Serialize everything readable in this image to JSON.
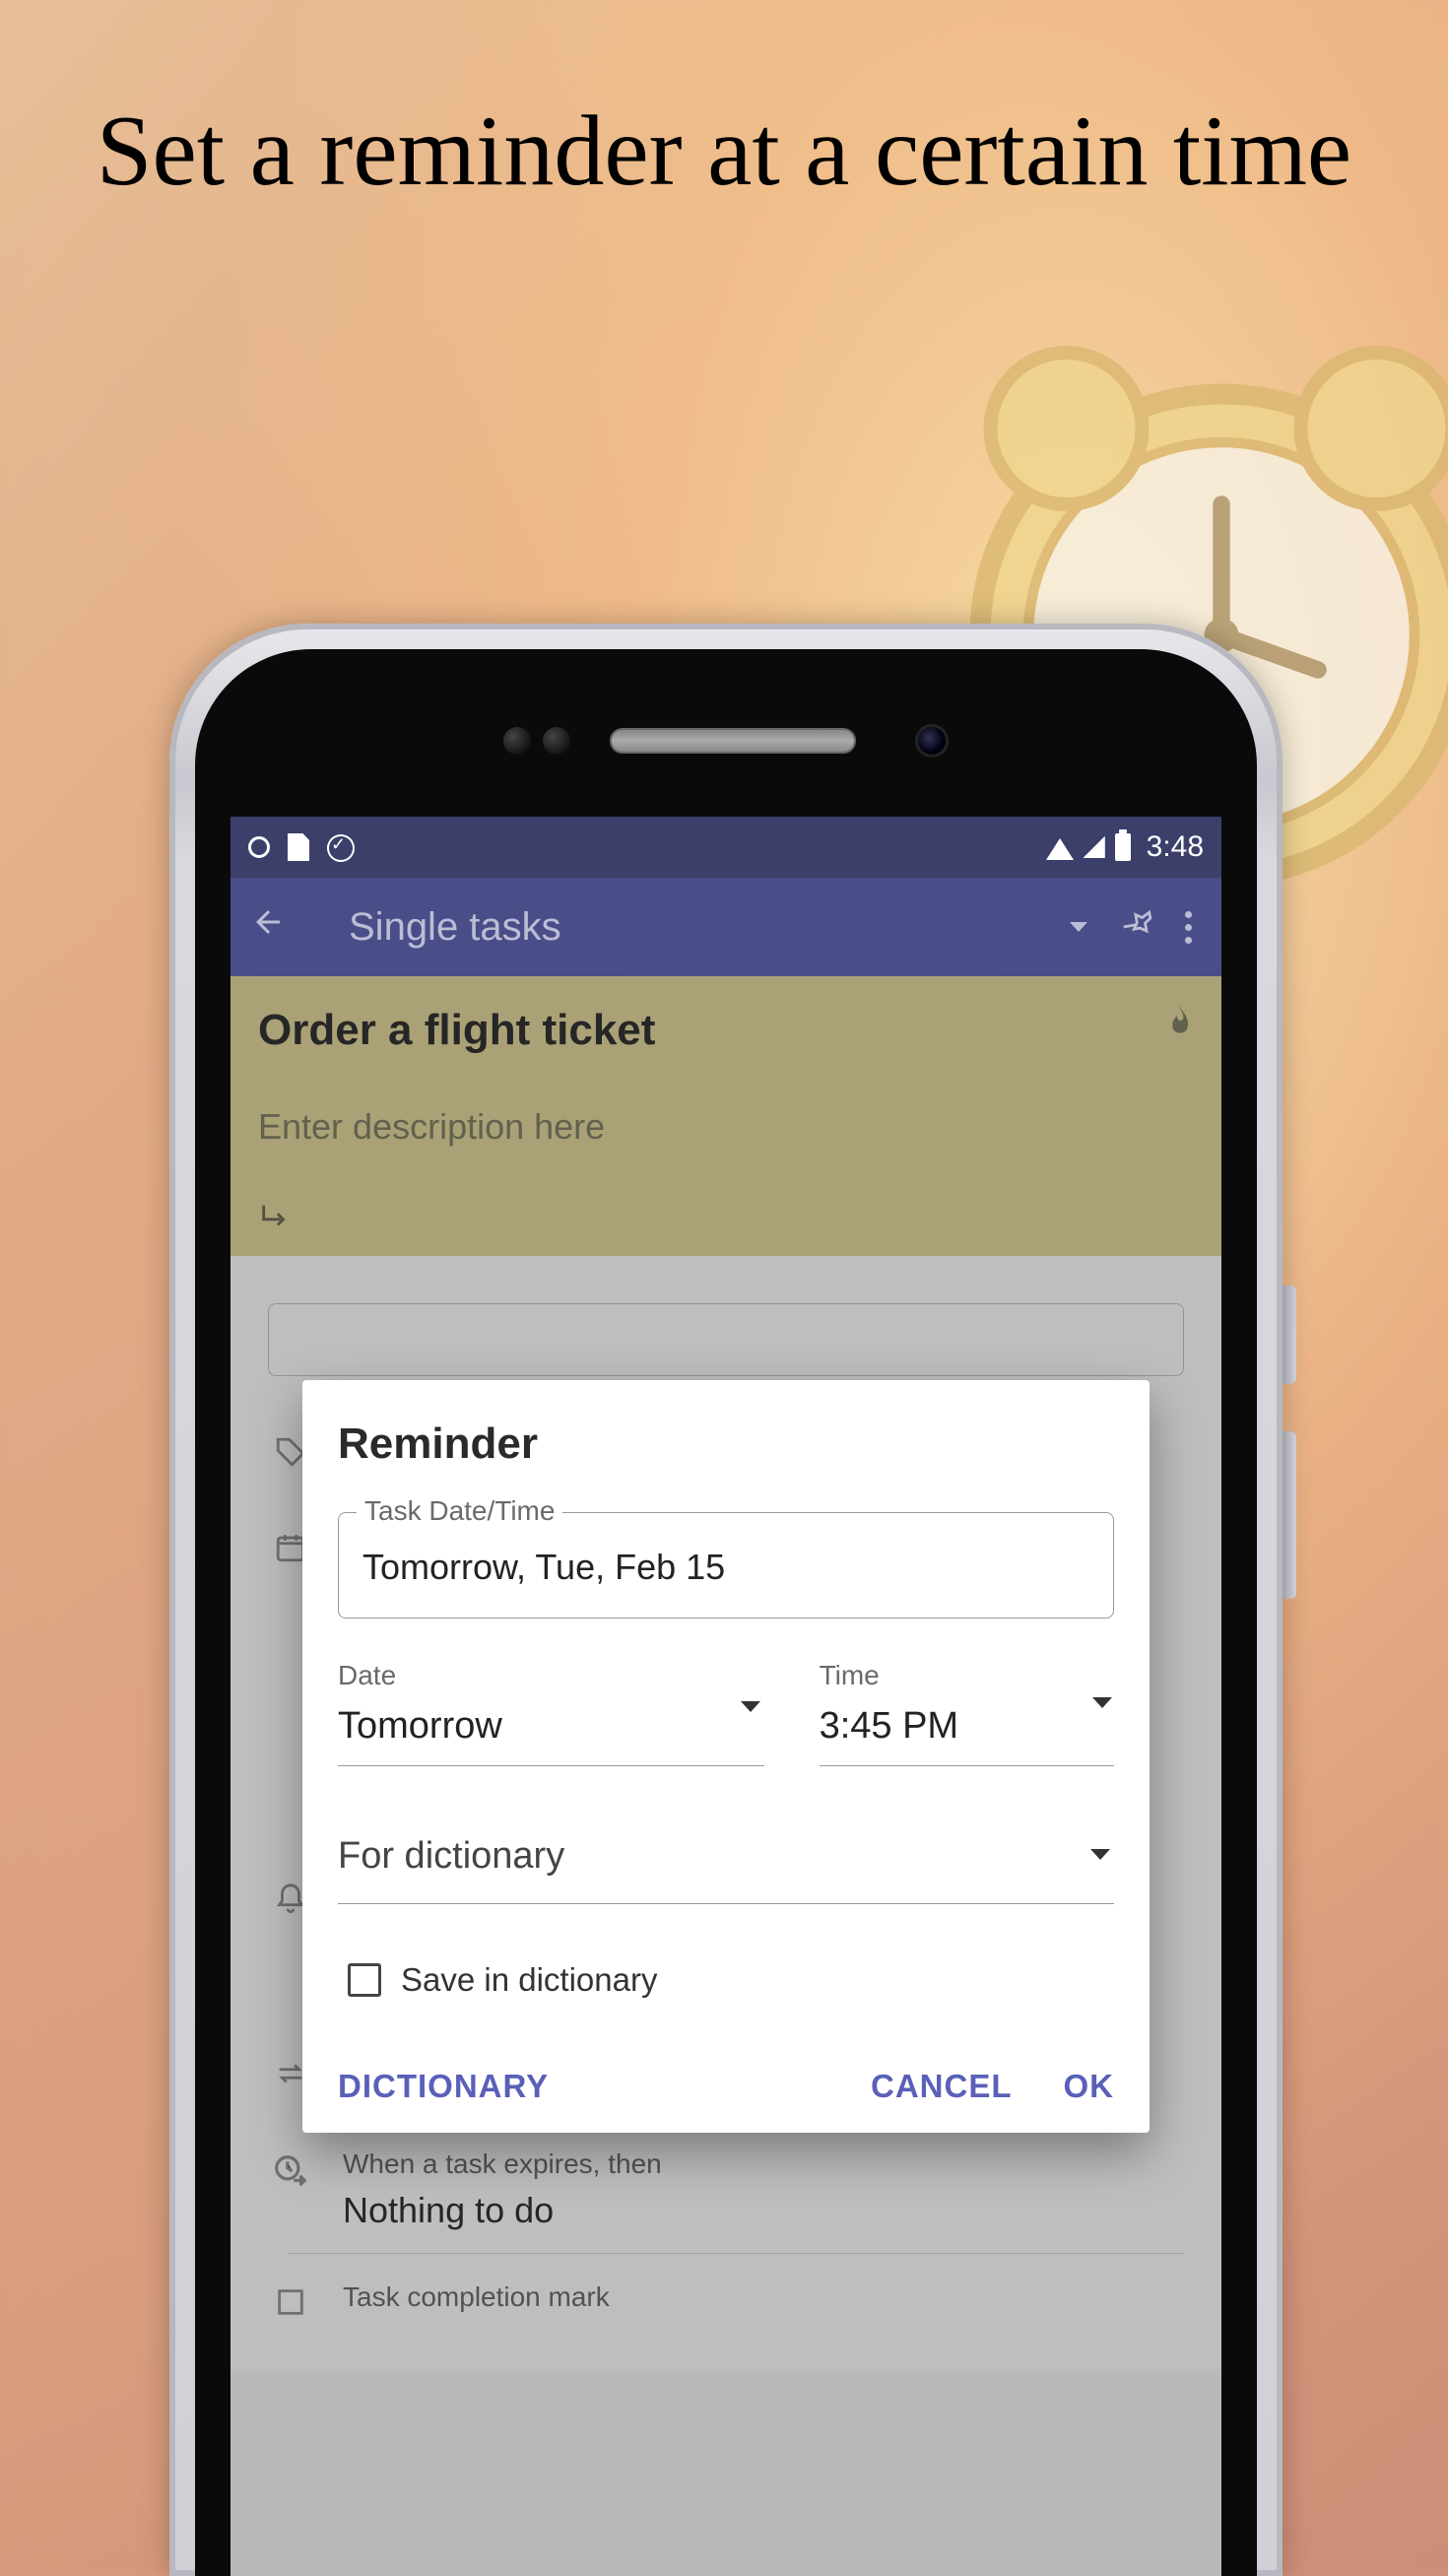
{
  "headline": "Set a reminder at a certain time",
  "statusbar": {
    "time": "3:48"
  },
  "appbar": {
    "title": "Single tasks"
  },
  "task": {
    "title": "Order a flight ticket",
    "description_placeholder": "Enter description here"
  },
  "lower_rows": {
    "expires_label": "When a task expires, then",
    "expires_value": "Nothing to do",
    "completion_label": "Task completion mark"
  },
  "modal": {
    "title": "Reminder",
    "task_dt_legend": "Task Date/Time",
    "task_dt_value": "Tomorrow, Tue, Feb 15",
    "date_label": "Date",
    "date_value": "Tomorrow",
    "time_label": "Time",
    "time_value": "3:45 PM",
    "dictionary_value": "For dictionary",
    "save_label": "Save in dictionary",
    "actions": {
      "dictionary": "DICTIONARY",
      "cancel": "CANCEL",
      "ok": "OK"
    }
  }
}
